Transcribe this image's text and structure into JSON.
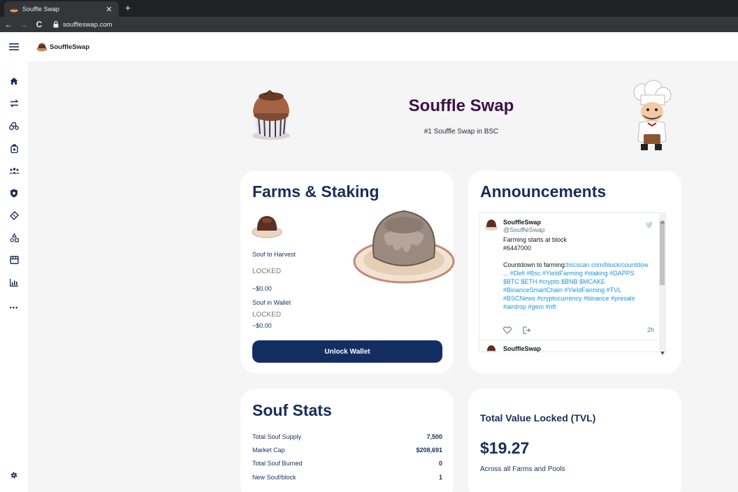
{
  "browser": {
    "tab_title": "Souffle Swap",
    "tab_close": "✕",
    "new_tab": "+",
    "back": "←",
    "forward": "→",
    "reload": "C",
    "url": "souffleswap.com"
  },
  "header": {
    "logo_text": "SouffleSwap"
  },
  "sidebar": {
    "items": [
      "home-icon",
      "swap-icon",
      "farm-icon",
      "pool-icon",
      "team-icon",
      "shield-icon",
      "ticket-icon",
      "nft-icon",
      "store-icon",
      "chart-icon",
      "more-icon"
    ],
    "more_label": "•••"
  },
  "hero": {
    "title": "Souffle Swap",
    "subtitle": "#1 Souffle Swap in BSC"
  },
  "farms": {
    "title": "Farms & Staking",
    "harvest_label": "Souf to Harvest",
    "harvest_value": "LOCKED",
    "harvest_usd": "~$0.00",
    "wallet_label": "Souf in Wallet",
    "wallet_value": "LOCKED",
    "wallet_usd": "~$0.00",
    "unlock_label": "Unlock Wallet"
  },
  "announcements": {
    "title": "Announcements",
    "tweet": {
      "name": "SouffleSwap",
      "handle": "@SouffleSwap",
      "line1": "Farming starts at block",
      "line2": "#6447000",
      "line3_prefix": "Countdown to farming:",
      "line3_link": "bscscan.com/block/countdow",
      "line4": "... #Defi #Bsc  #YieldFarming #staking #DAPPS",
      "line5": "$BTC $ETH #crypto $BNB $MCAKE",
      "line6": "#BinanceSmartChain  #YieldFarming #TVL",
      "line7": "#BSCNews #cryptocurrency #binance  #presale",
      "line8": "#airdrop #gem #nft",
      "time": "2h"
    },
    "tweet2_name": "SouffleSwap"
  },
  "stats": {
    "title": "Souf Stats",
    "rows": [
      {
        "label": "Total Souf Supply",
        "value": "7,500"
      },
      {
        "label": "Market Cap",
        "value": "$208,691"
      },
      {
        "label": "Total Souf Burned",
        "value": "0"
      },
      {
        "label": "New Souf/block",
        "value": "1"
      }
    ]
  },
  "tvl": {
    "title": "Total Value Locked (TVL)",
    "value": "$19.27",
    "subtitle": "Across all Farms and Pools"
  },
  "colors": {
    "brand_navy": "#1a2d58",
    "button": "#142e62",
    "title_purple": "#3d1145",
    "twitter_link": "#1b95e0"
  }
}
